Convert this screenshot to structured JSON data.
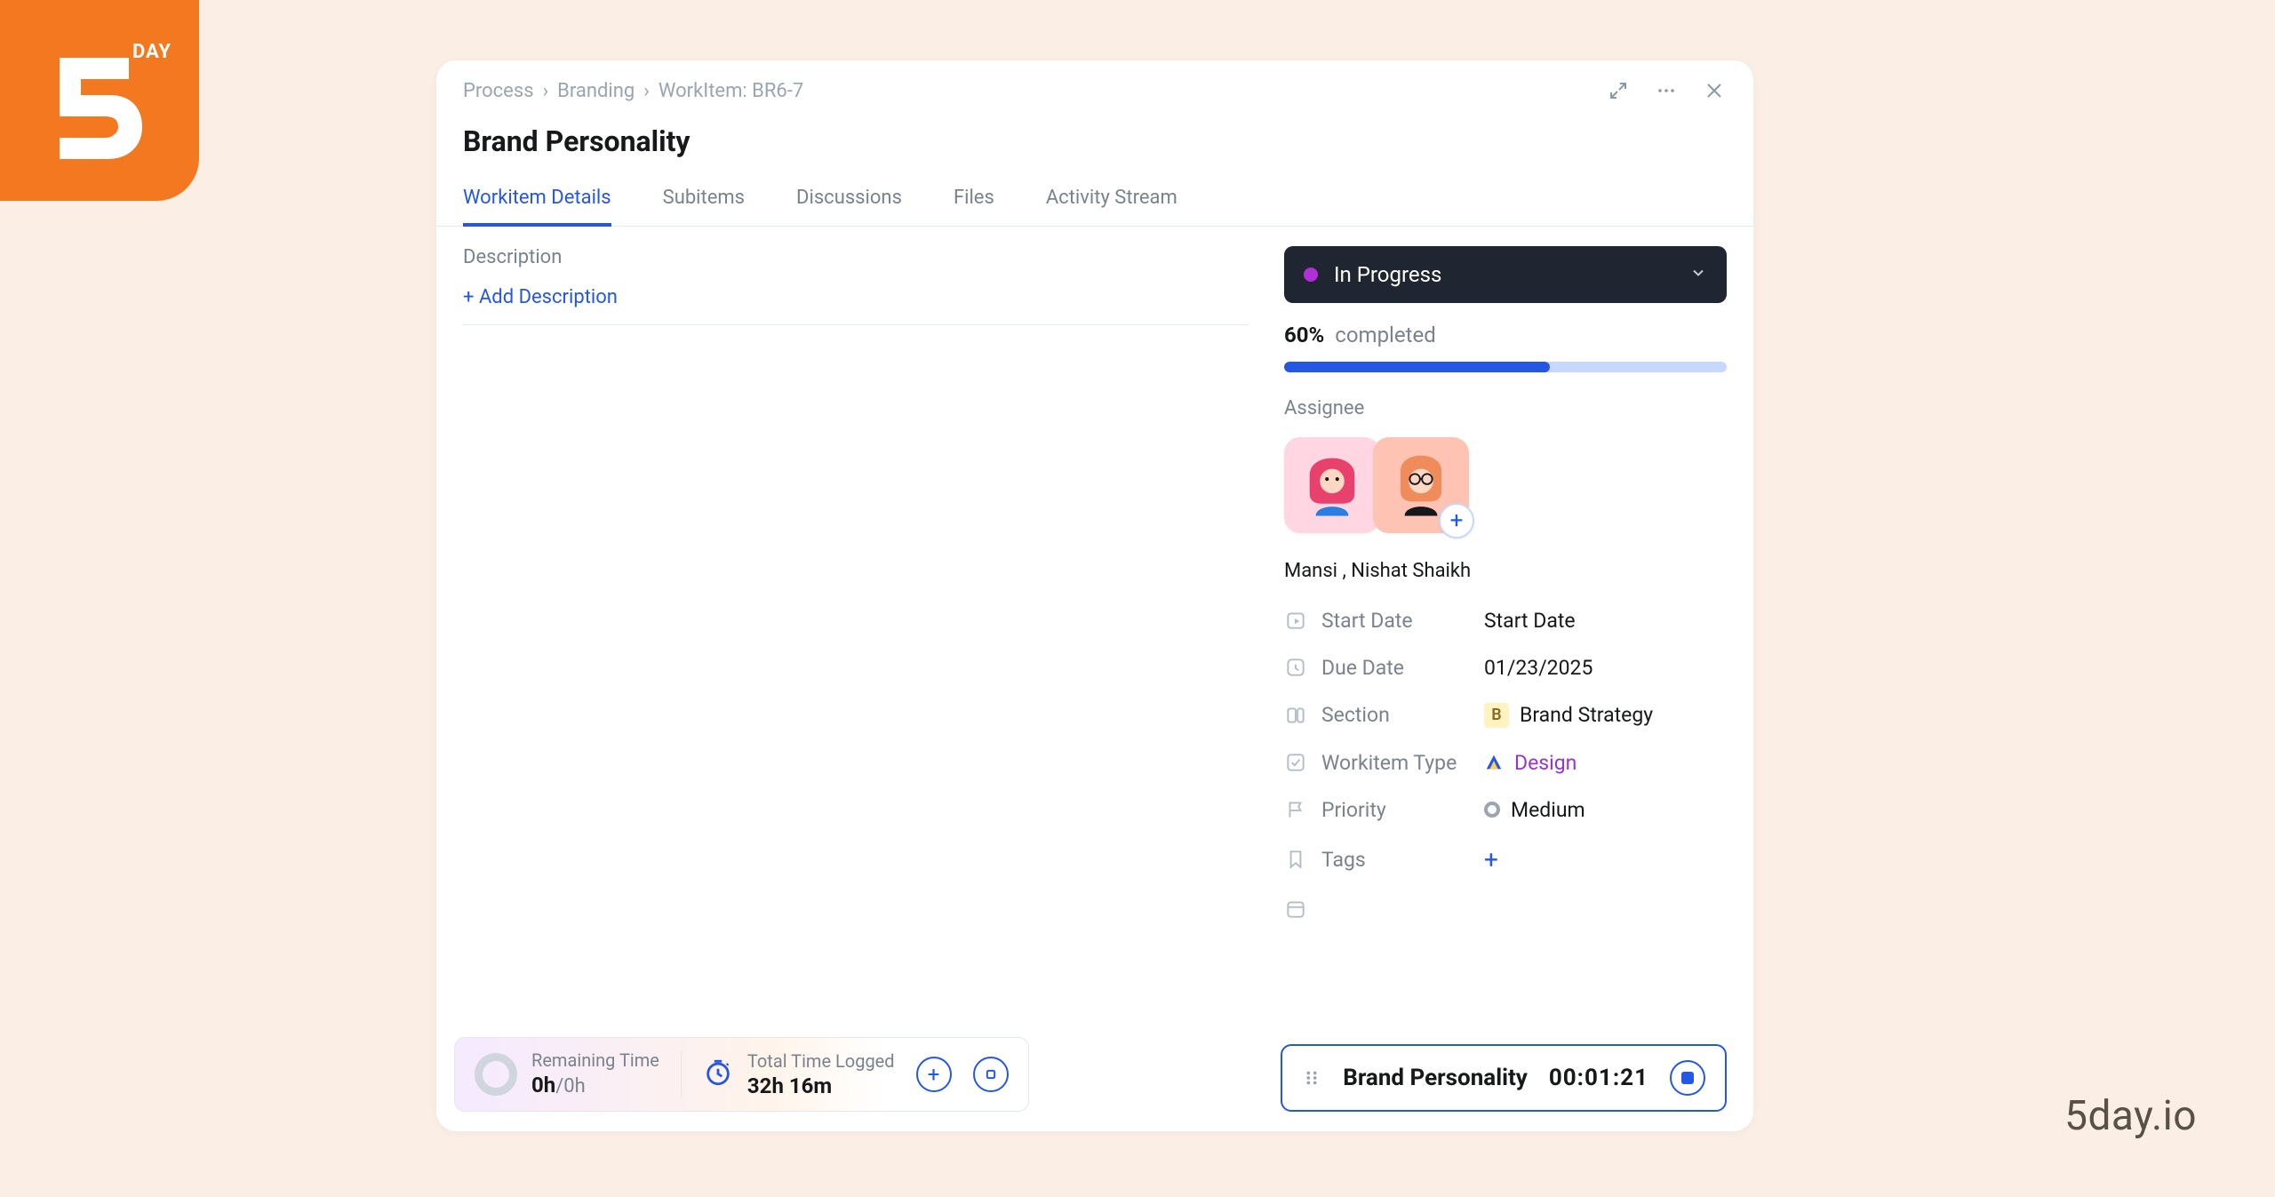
{
  "brand": {
    "name": "5DAY",
    "small": "DAY",
    "domain": "5day.io"
  },
  "breadcrumb": [
    "Process",
    "Branding",
    "WorkItem: BR6-7"
  ],
  "title": "Brand Personality",
  "tabs": [
    "Workitem Details",
    "Subitems",
    "Discussions",
    "Files",
    "Activity Stream"
  ],
  "active_tab_index": 0,
  "description": {
    "label": "Description",
    "add_link": "+ Add Description"
  },
  "status": {
    "label": "In Progress"
  },
  "progress": {
    "pct": "60%",
    "label": "completed",
    "value": 60
  },
  "assignees": {
    "label": "Assignee",
    "names": "Mansi , Nishat Shaikh"
  },
  "meta": {
    "start_date": {
      "label": "Start Date",
      "value": "Start Date"
    },
    "due_date": {
      "label": "Due Date",
      "value": "01/23/2025"
    },
    "section": {
      "label": "Section",
      "badge": "B",
      "value": "Brand Strategy"
    },
    "workitem": {
      "label": "Workitem Type",
      "value": "Design"
    },
    "priority": {
      "label": "Priority",
      "value": "Medium"
    },
    "tags": {
      "label": "Tags",
      "add": "+"
    }
  },
  "time_left": {
    "remaining_label": "Remaining Time",
    "remaining_value": "0h",
    "remaining_total": "/0h",
    "logged_label": "Total Time Logged",
    "logged_value": "32h 16m"
  },
  "timer": {
    "title": "Brand Personality",
    "elapsed": "00:01:21"
  }
}
